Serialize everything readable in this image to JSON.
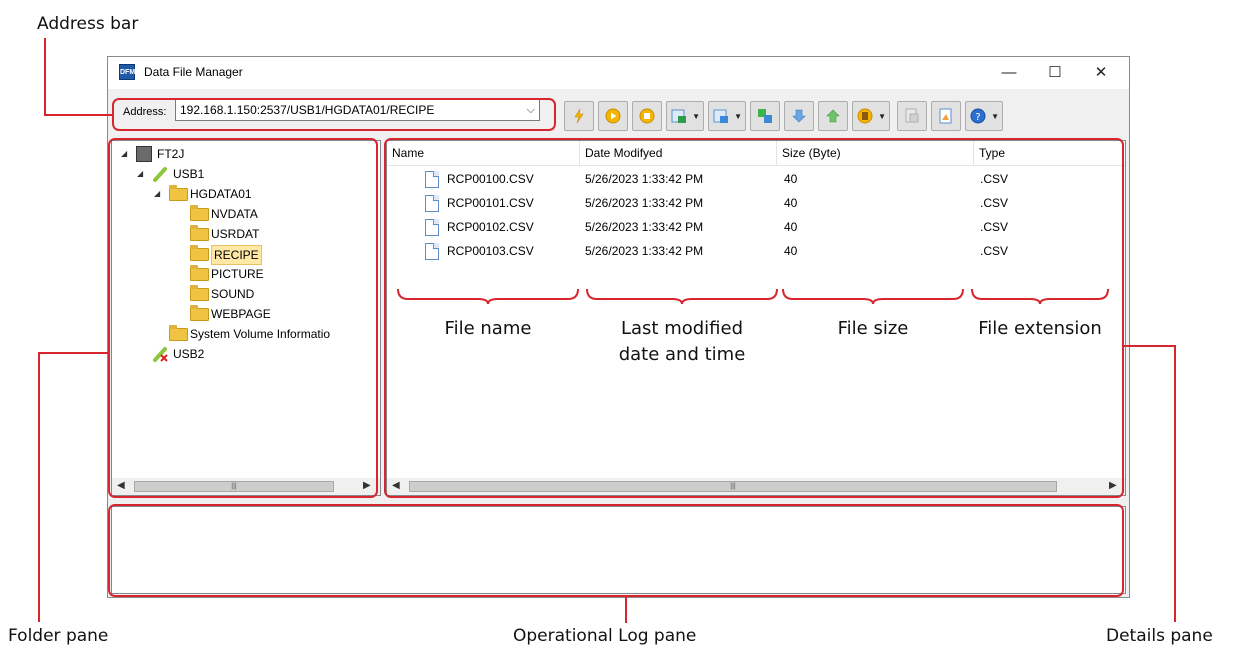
{
  "callouts": {
    "address_bar": "Address bar",
    "folder_pane": "Folder pane",
    "log_pane": "Operational Log pane",
    "details_pane": "Details pane",
    "file_name": "File name",
    "last_modified": "Last modified\ndate and time",
    "file_size": "File size",
    "file_extension": "File extension"
  },
  "window": {
    "title": "Data File Manager",
    "icon_text": "DFM",
    "minimize": "—",
    "maximize": "☐",
    "close": "✕"
  },
  "toolbar": {
    "address_label": "Address:",
    "address_value": "192.168.1.150:2537/USB1/HGDATA01/RECIPE",
    "buttons": [
      "lightning-icon",
      "play-icon",
      "stop-icon",
      "download-icon",
      "upload-icon",
      "copy-icon",
      "import-icon",
      "export-icon",
      "globe-icon",
      "disabled-copy-icon",
      "properties-icon",
      "help-icon"
    ]
  },
  "folder_tree": [
    {
      "label": "FT2J",
      "level": 0,
      "expanded": true,
      "icon": "device-icon"
    },
    {
      "label": "USB1",
      "level": 1,
      "expanded": true,
      "icon": "usb-icon"
    },
    {
      "label": "HGDATA01",
      "level": 2,
      "expanded": true,
      "icon": "folder-open-icon"
    },
    {
      "label": "NVDATA",
      "level": 3,
      "icon": "folder-icon"
    },
    {
      "label": "USRDAT",
      "level": 3,
      "icon": "folder-icon"
    },
    {
      "label": "RECIPE",
      "level": 3,
      "icon": "folder-icon",
      "selected": true
    },
    {
      "label": "PICTURE",
      "level": 3,
      "icon": "folder-icon"
    },
    {
      "label": "SOUND",
      "level": 3,
      "icon": "folder-icon"
    },
    {
      "label": "WEBPAGE",
      "level": 3,
      "icon": "folder-icon"
    },
    {
      "label": "System Volume Informatio",
      "level": 2,
      "icon": "folder-icon"
    },
    {
      "label": "USB2",
      "level": 1,
      "icon": "usb-disconnected-icon"
    }
  ],
  "details": {
    "columns": [
      "Name",
      "Date Modifyed",
      "Size (Byte)",
      "Type"
    ],
    "files": [
      {
        "name": "RCP00100.CSV",
        "date": "5/26/2023 1:33:42 PM",
        "size": "40",
        "type": ".CSV"
      },
      {
        "name": "RCP00101.CSV",
        "date": "5/26/2023 1:33:42 PM",
        "size": "40",
        "type": ".CSV"
      },
      {
        "name": "RCP00102.CSV",
        "date": "5/26/2023 1:33:42 PM",
        "size": "40",
        "type": ".CSV"
      },
      {
        "name": "RCP00103.CSV",
        "date": "5/26/2023 1:33:42 PM",
        "size": "40",
        "type": ".CSV"
      }
    ]
  },
  "scrollbar": {
    "left_arrow": "◀",
    "right_arrow": "▶",
    "grip": "|||"
  },
  "colors": {
    "callout_red": "#d7262e",
    "folder_yellow": "#f0c442",
    "selection": "#ffe8a6"
  }
}
